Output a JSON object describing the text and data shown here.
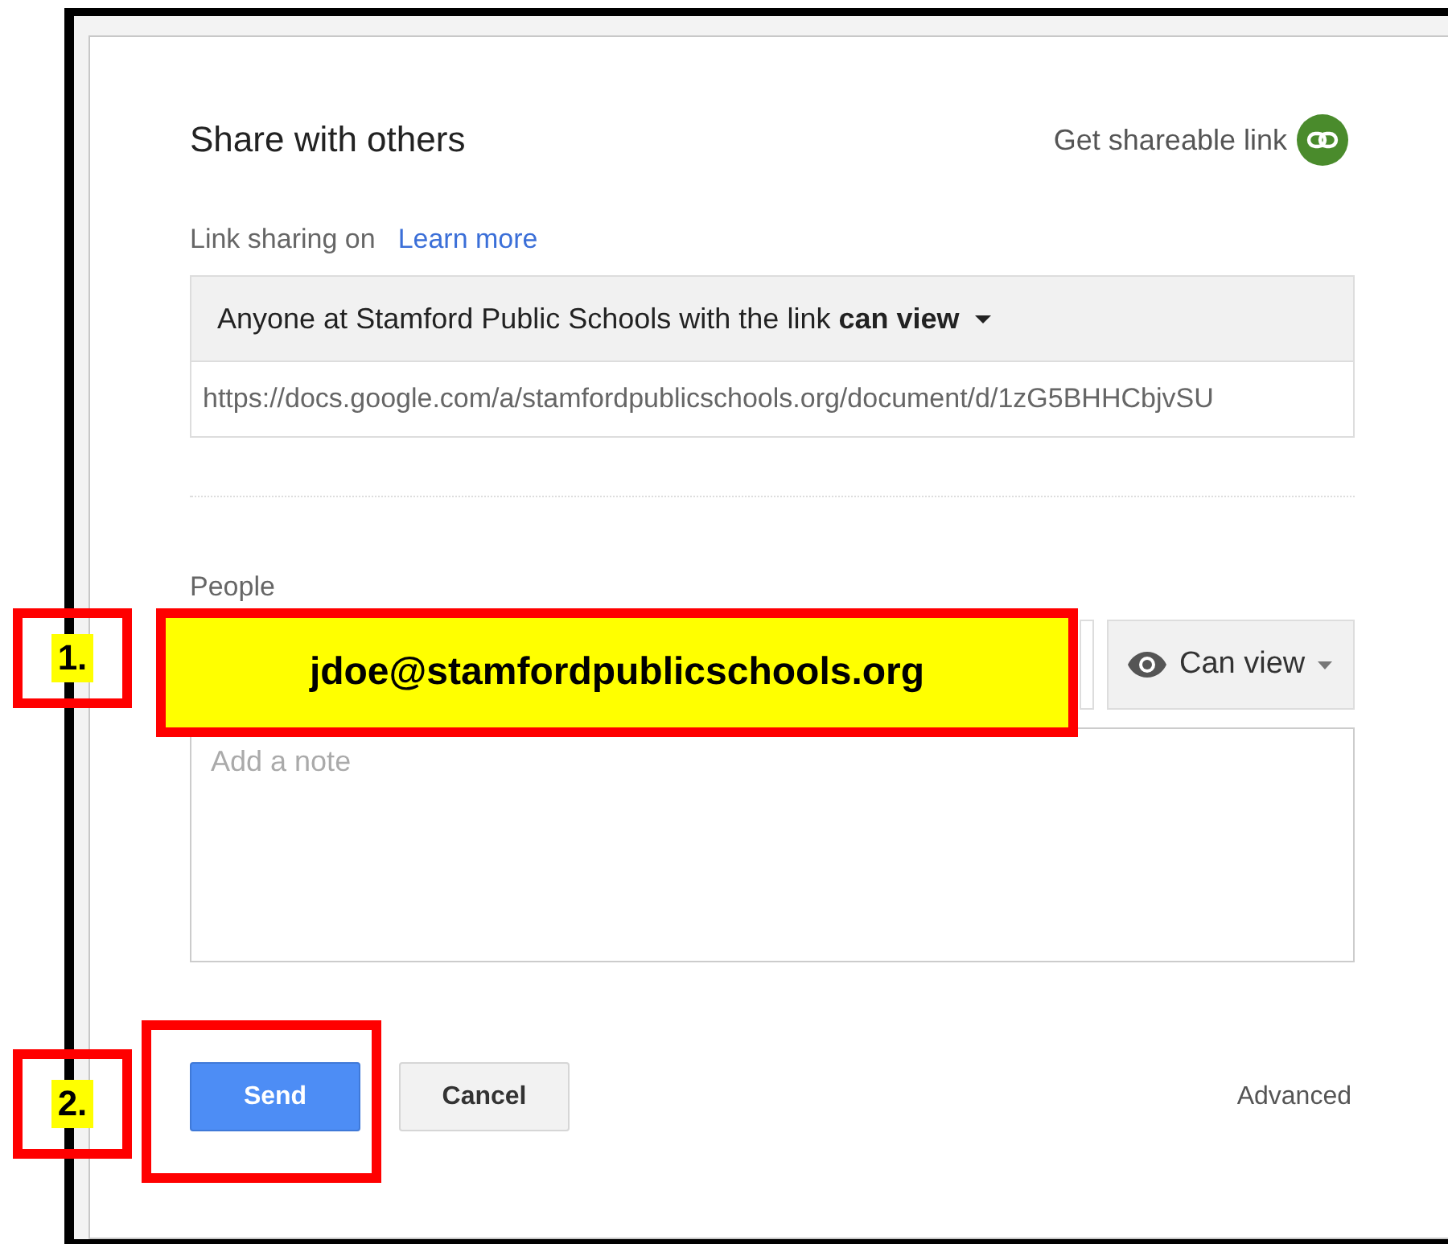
{
  "dialog": {
    "title": "Share with others",
    "shareable_link": "Get shareable link",
    "link_sharing": {
      "label": "Link sharing on",
      "learn_more": "Learn more",
      "access": "Anyone at Stamford Public Schools with the link **can view**",
      "url": "https://docs.google.com/a/stamfordpublicschools.org/document/d/1zG5BHHCbjvSU"
    },
    "people": {
      "label": "People",
      "permission": "Can view",
      "note_placeholder": "Add a note"
    },
    "buttons": [
      {
        "label": "Send",
        "kind": "primary"
      },
      {
        "label": "Cancel",
        "kind": "secondary"
      }
    ],
    "advanced": "Advanced"
  },
  "annotations": [
    {
      "kind": "step",
      "label": "1."
    },
    {
      "kind": "callout",
      "label": "jdoe@stamfordpublicschools.org"
    },
    {
      "kind": "step",
      "label": "2."
    },
    {
      "kind": "outline"
    }
  ]
}
